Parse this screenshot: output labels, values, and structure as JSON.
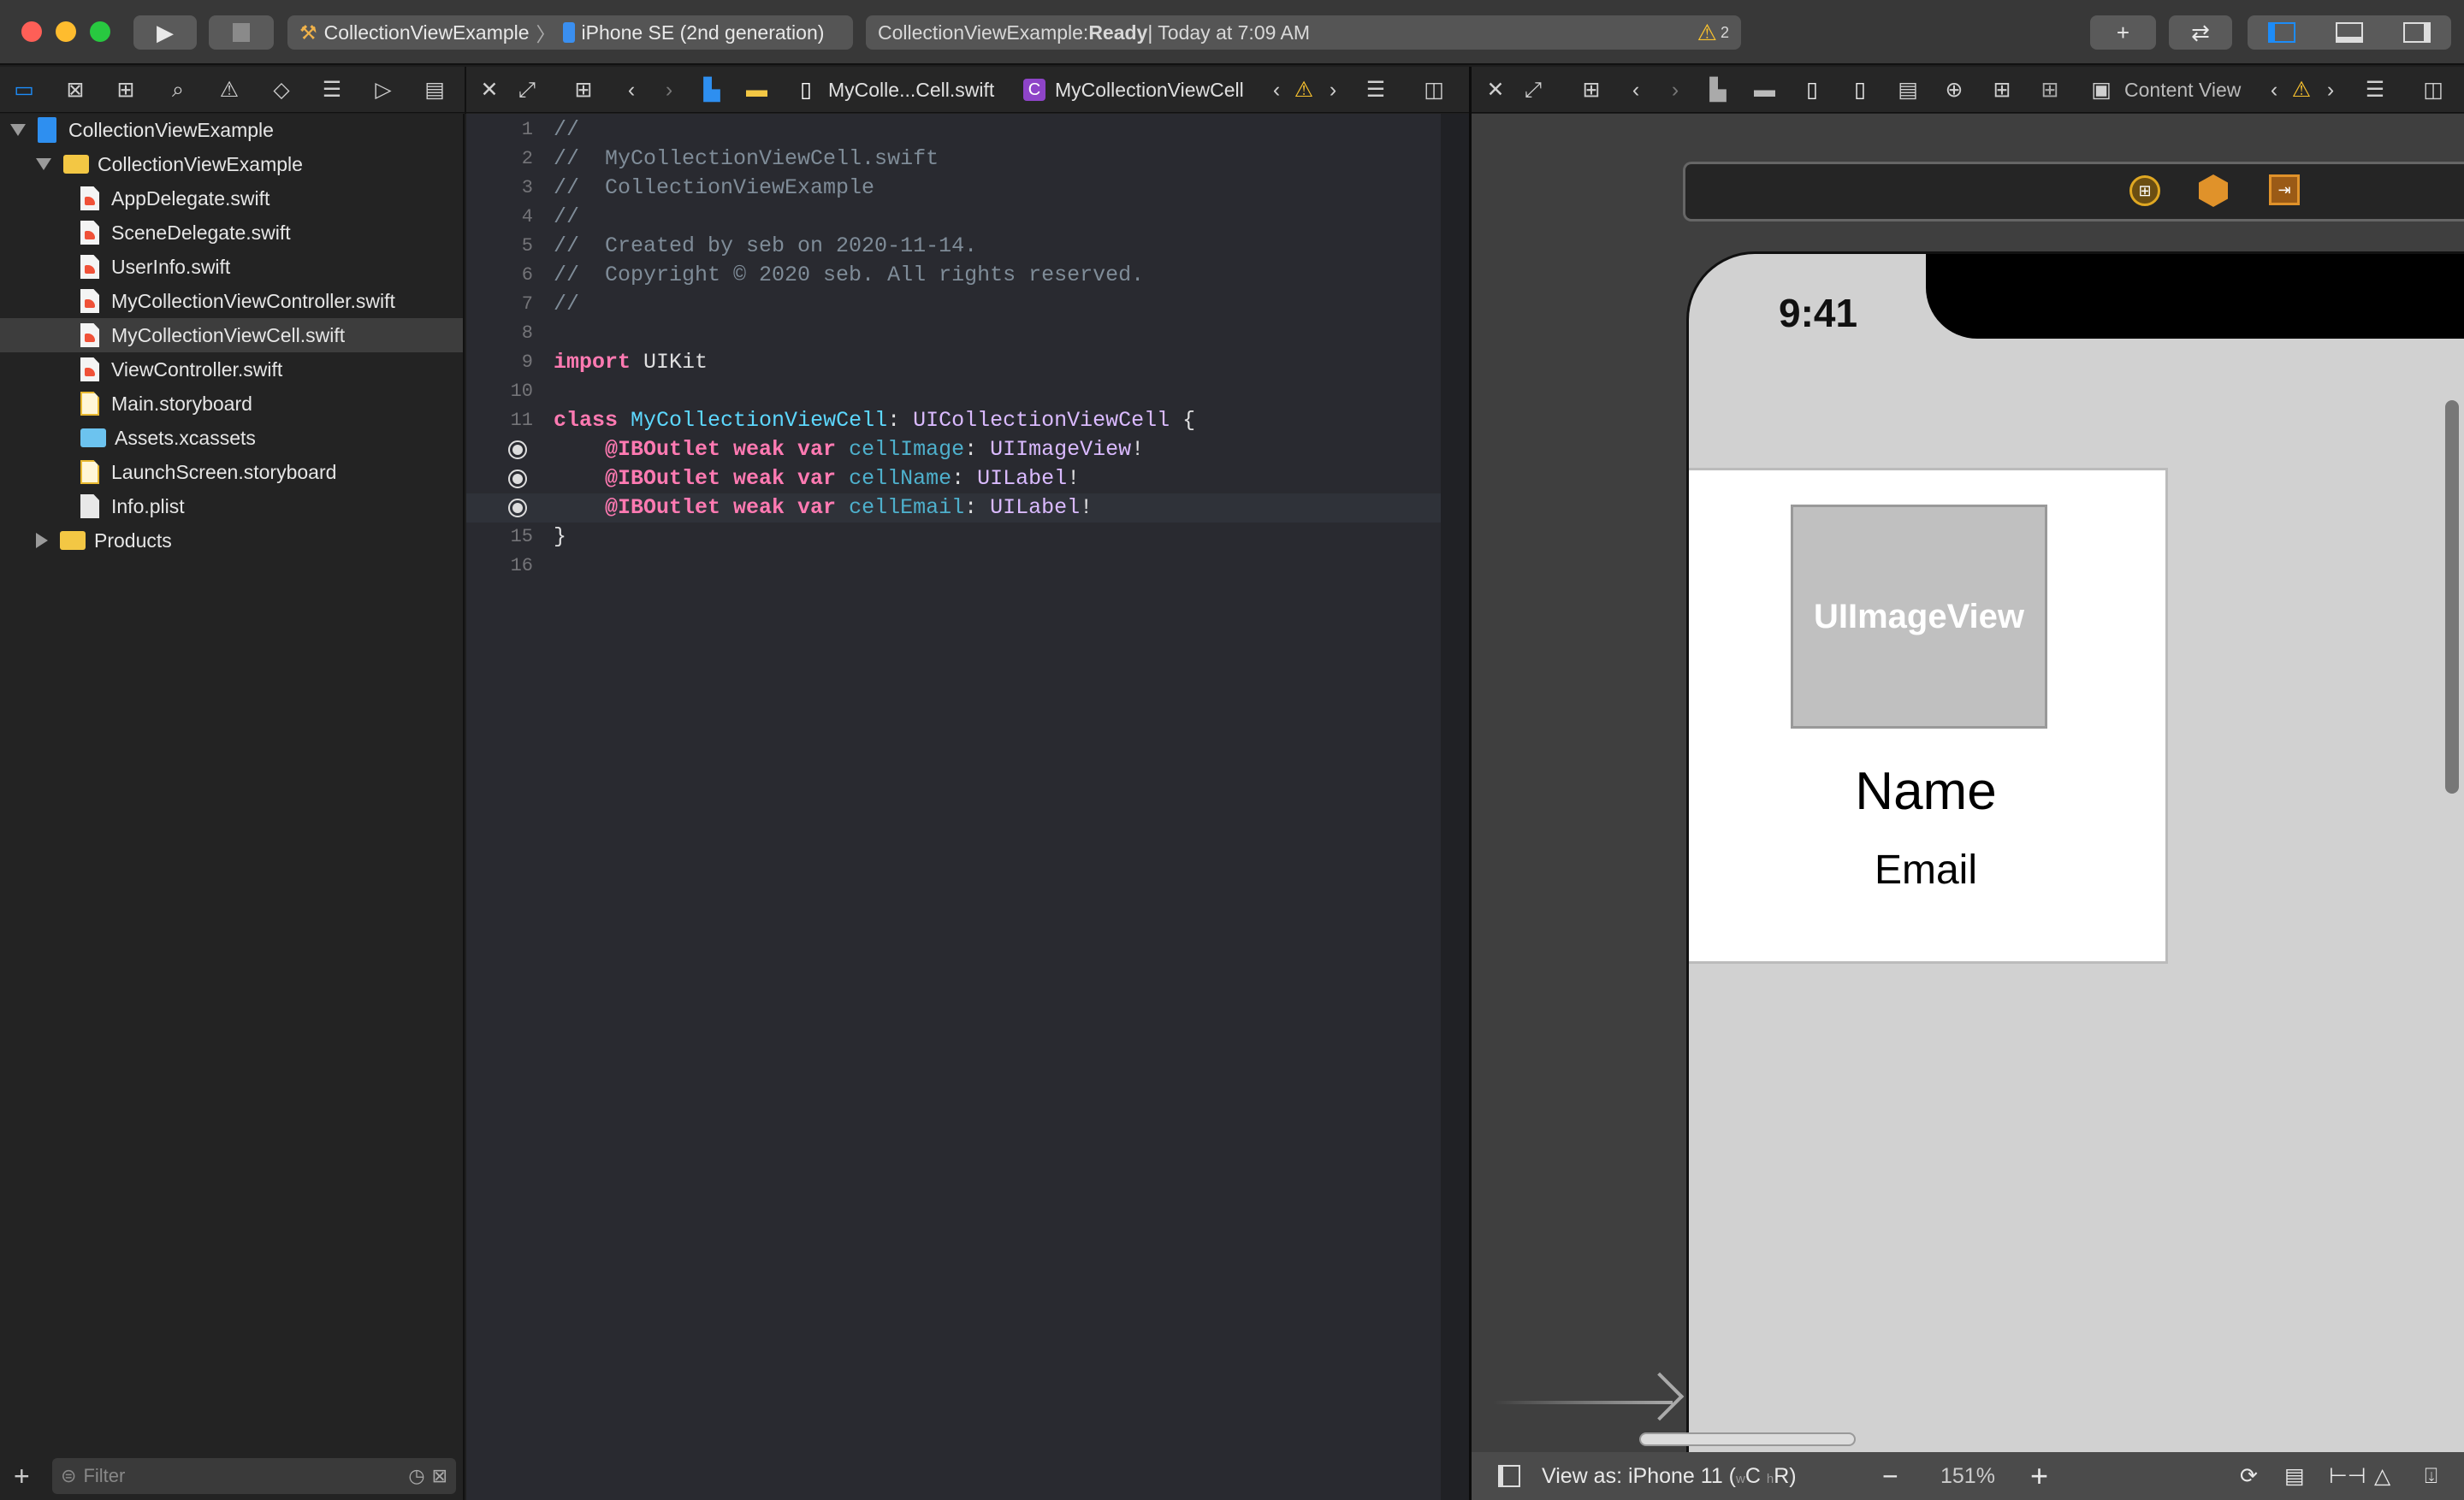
{
  "titlebar": {
    "scheme": "CollectionViewExample",
    "device": "iPhone SE (2nd generation)",
    "status_project": "CollectionViewExample: ",
    "status_state": "Ready",
    "status_time": " | Today at 7:09 AM",
    "warning_count": "2",
    "icons": [
      "play-icon",
      "stop-icon",
      "plus-icon",
      "swap-icon",
      "navigator-toggle-icon",
      "debug-area-toggle-icon",
      "inspector-toggle-icon"
    ]
  },
  "navigator": {
    "tabs": [
      "project-navigator",
      "source-control",
      "symbol",
      "find",
      "issue",
      "test",
      "debug",
      "breakpoint",
      "report"
    ],
    "items": [
      {
        "label": "CollectionViewExample",
        "kind": "project",
        "level": 0,
        "expanded": true
      },
      {
        "label": "CollectionViewExample",
        "kind": "folder",
        "level": 1,
        "expanded": true
      },
      {
        "label": "AppDelegate.swift",
        "kind": "swift",
        "level": 2
      },
      {
        "label": "SceneDelegate.swift",
        "kind": "swift",
        "level": 2
      },
      {
        "label": "UserInfo.swift",
        "kind": "swift",
        "level": 2
      },
      {
        "label": "MyCollectionViewController.swift",
        "kind": "swift",
        "level": 2
      },
      {
        "label": "MyCollectionViewCell.swift",
        "kind": "swift",
        "level": 2,
        "selected": true
      },
      {
        "label": "ViewController.swift",
        "kind": "swift",
        "level": 2
      },
      {
        "label": "Main.storyboard",
        "kind": "storyboard",
        "level": 2
      },
      {
        "label": "Assets.xcassets",
        "kind": "assets",
        "level": 2
      },
      {
        "label": "LaunchScreen.storyboard",
        "kind": "storyboard",
        "level": 2
      },
      {
        "label": "Info.plist",
        "kind": "plist",
        "level": 2
      },
      {
        "label": "Products",
        "kind": "folder",
        "level": 1,
        "expanded": false
      }
    ],
    "filter_placeholder": "Filter"
  },
  "editor": {
    "jumpbar_file": "MyColle...Cell.swift",
    "jumpbar_symbol": "MyCollectionViewCell",
    "symbol_badge": "C",
    "current_line": 14,
    "lines": [
      [
        {
          "t": "//",
          "k": "comment"
        }
      ],
      [
        {
          "t": "//  MyCollectionViewCell.swift",
          "k": "comment"
        }
      ],
      [
        {
          "t": "//  CollectionViewExample",
          "k": "comment"
        }
      ],
      [
        {
          "t": "//",
          "k": "comment"
        }
      ],
      [
        {
          "t": "//  Created by seb on 2020-11-14.",
          "k": "comment"
        }
      ],
      [
        {
          "t": "//  Copyright © 2020 seb. All rights reserved.",
          "k": "comment"
        }
      ],
      [
        {
          "t": "//",
          "k": "comment"
        }
      ],
      [],
      [
        {
          "t": "import",
          "k": "keyword"
        },
        {
          "t": " UIKit",
          "k": "plain"
        }
      ],
      [],
      [
        {
          "t": "class",
          "k": "keyword"
        },
        {
          "t": " ",
          "k": "plain"
        },
        {
          "t": "MyCollectionViewCell",
          "k": "decl"
        },
        {
          "t": ": ",
          "k": "plain"
        },
        {
          "t": "UICollectionViewCell",
          "k": "type"
        },
        {
          "t": " {",
          "k": "plain"
        }
      ],
      [
        {
          "t": "    ",
          "k": "plain"
        },
        {
          "t": "@IBOutlet weak var",
          "k": "keyword"
        },
        {
          "t": " ",
          "k": "plain"
        },
        {
          "t": "cellImage",
          "k": "prop"
        },
        {
          "t": ": ",
          "k": "plain"
        },
        {
          "t": "UIImageView",
          "k": "type"
        },
        {
          "t": "!",
          "k": "plain"
        }
      ],
      [
        {
          "t": "    ",
          "k": "plain"
        },
        {
          "t": "@IBOutlet weak var",
          "k": "keyword"
        },
        {
          "t": " ",
          "k": "plain"
        },
        {
          "t": "cellName",
          "k": "prop"
        },
        {
          "t": ": ",
          "k": "plain"
        },
        {
          "t": "UILabel",
          "k": "type"
        },
        {
          "t": "!",
          "k": "plain"
        }
      ],
      [
        {
          "t": "    ",
          "k": "plain"
        },
        {
          "t": "@IBOutlet weak var",
          "k": "keyword"
        },
        {
          "t": " ",
          "k": "plain"
        },
        {
          "t": "cellEmail",
          "k": "prop"
        },
        {
          "t": ": ",
          "k": "plain"
        },
        {
          "t": "UILabel",
          "k": "type"
        },
        {
          "t": "!",
          "k": "plain"
        }
      ],
      [
        {
          "t": "}",
          "k": "plain"
        }
      ],
      []
    ],
    "outlet_lines": [
      12,
      13,
      14
    ]
  },
  "canvas": {
    "jumpbar_label": "Content View",
    "status_time": "9:41",
    "image_view_label": "UIImageView",
    "name_label": "Name",
    "email_label": "Email",
    "view_as_prefix": "View as: iPhone 11 (",
    "size_w": "w",
    "size_w_val": "C",
    "size_h": "h",
    "size_h_val": "R",
    "view_as_suffix": ")",
    "zoom": "151%",
    "colors": {
      "background": "#3f3f3f",
      "device_screen": "#d1d1d1",
      "image_view": "#c0c0c0"
    }
  },
  "colors": {
    "accent": "#1d8cf8",
    "warning": "#f9c22e"
  }
}
